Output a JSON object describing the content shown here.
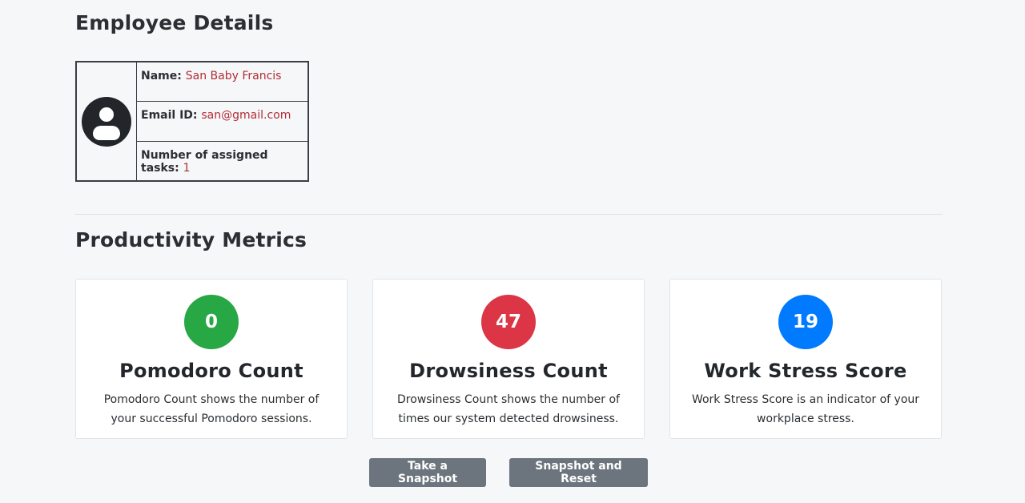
{
  "employee_section": {
    "title": "Employee Details",
    "avatar_icon": "user-avatar-icon",
    "name_label": "Name:",
    "name_value": "San Baby Francis",
    "email_label": "Email ID:",
    "email_value": "san@gmail.com",
    "tasks_label": "Number of assigned tasks:",
    "tasks_value": "1"
  },
  "metrics_section": {
    "title": "Productivity Metrics",
    "cards": [
      {
        "value": "0",
        "color": "#28a745",
        "title": "Pomodoro Count",
        "description": "Pomodoro Count shows the number of your successful Pomodoro sessions."
      },
      {
        "value": "47",
        "color": "#dc3545",
        "title": "Drowsiness Count",
        "description": "Drowsiness Count shows the number of times our system detected drowsiness."
      },
      {
        "value": "19",
        "color": "#007bff",
        "title": "Work Stress Score",
        "description": "Work Stress Score is an indicator of your workplace stress."
      }
    ]
  },
  "actions": {
    "snapshot_label": "Take a Snapshot",
    "snapshot_reset_label": "Snapshot and Reset",
    "button_color": "#6c757d"
  }
}
